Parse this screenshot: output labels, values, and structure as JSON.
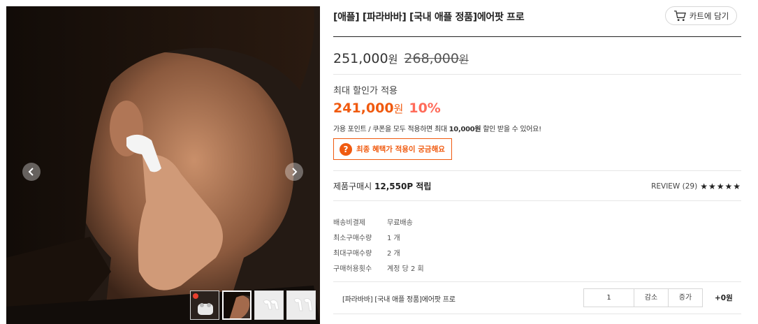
{
  "product": {
    "title": "[애플] [파라바바] [국내 애플 정품]에어팟 프로",
    "cart_label": "카트에 담기",
    "price": {
      "current": "251,000",
      "original": "268,000",
      "currency": "원"
    },
    "max_discount": {
      "label": "최대 할인가 적용",
      "price": "241,000",
      "currency": "원",
      "rate": "10%",
      "note_prefix": "가용 포인트 / 쿠폰을 모두 적용하면 최대",
      "note_amount": "10,000원",
      "note_suffix": "할인 받을 수 있어요!"
    },
    "benefit_button": "최종 혜택가 적용이 궁금해요",
    "points": {
      "label": "제품구매시",
      "value": "12,550P 적립"
    },
    "review": {
      "label": "REVIEW (29)",
      "stars": "★★★★★",
      "rating": 5
    },
    "info": [
      {
        "key": "배송비결제",
        "value": "무료배송"
      },
      {
        "key": "최소구매수량",
        "value": "1 개"
      },
      {
        "key": "최대구매수량",
        "value": "2 개"
      },
      {
        "key": "구매허용횟수",
        "value": "계정 당 2 회"
      }
    ],
    "option": {
      "name": "[파라바바] [국내 애플 정품]에어팟 프로",
      "quantity": "1",
      "minus_label": "감소",
      "plus_label": "증가",
      "price": "+0원"
    }
  },
  "gallery": {
    "icons": {
      "prev": "chevron-left-icon",
      "next": "chevron-right-icon",
      "cart": "cart-icon",
      "question": "question-icon"
    },
    "thumbnail_count": 4,
    "active_thumbnail": 2
  },
  "colors": {
    "accent": "#f05a0f",
    "rate": "#ff6b5a",
    "rule": "#222222"
  }
}
